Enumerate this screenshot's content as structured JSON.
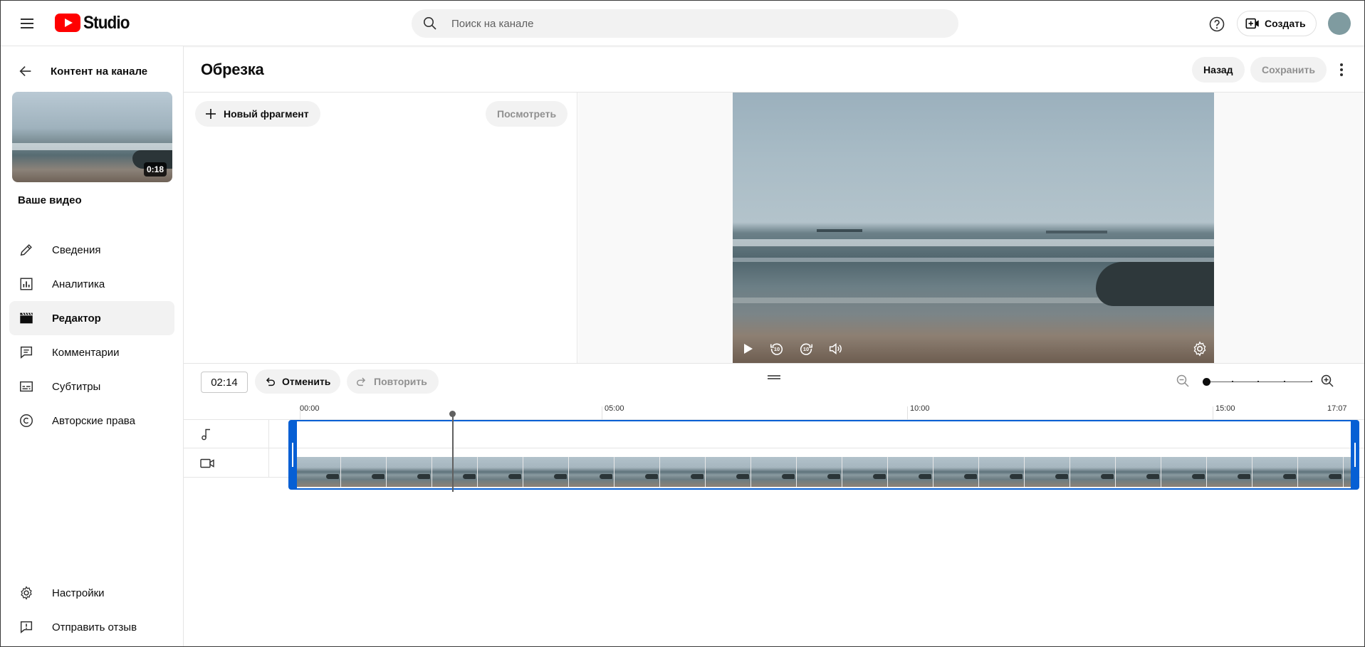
{
  "app": {
    "logo_text": "Studio",
    "brand_color": "#ff0000",
    "accent_color": "#065fd4"
  },
  "topbar": {
    "search_placeholder": "Поиск на канале",
    "create_label": "Создать",
    "icons": [
      "menu-icon",
      "search-icon",
      "help-icon",
      "create-video-icon"
    ]
  },
  "sidebar": {
    "back_label": "Контент на канале",
    "thumbnail_duration": "0:18",
    "your_video": "Ваше видео",
    "items": [
      {
        "label": "Сведения",
        "icon": "pencil-icon",
        "active": false
      },
      {
        "label": "Аналитика",
        "icon": "analytics-icon",
        "active": false
      },
      {
        "label": "Редактор",
        "icon": "clapperboard-icon",
        "active": true
      },
      {
        "label": "Комментарии",
        "icon": "comment-icon",
        "active": false
      },
      {
        "label": "Субтитры",
        "icon": "subtitles-icon",
        "active": false
      },
      {
        "label": "Авторские права",
        "icon": "copyright-icon",
        "active": false
      }
    ],
    "bottom_items": [
      {
        "label": "Настройки",
        "icon": "gear-icon"
      },
      {
        "label": "Отправить отзыв",
        "icon": "feedback-icon"
      }
    ]
  },
  "editor": {
    "title": "Обрезка",
    "back_label": "Назад",
    "save_label": "Сохранить",
    "new_fragment_label": "Новый фрагмент",
    "preview_label": "Посмотреть"
  },
  "timeline": {
    "current_time": "02:14",
    "undo_label": "Отменить",
    "redo_label": "Повторить",
    "ruler_labels": [
      "00:00",
      "05:00",
      "10:00",
      "15:00",
      "17:07"
    ],
    "zoom_level_fraction": 0
  }
}
